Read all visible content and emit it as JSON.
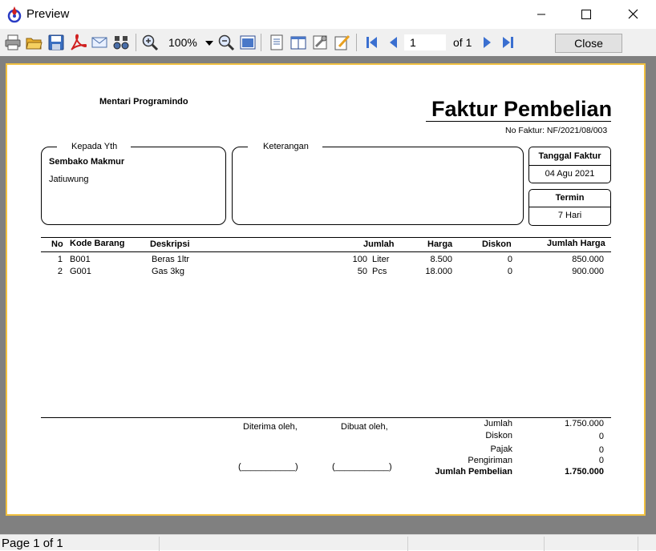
{
  "window": {
    "title": "Preview",
    "icon": "app-icon"
  },
  "toolbar": {
    "icons": [
      "print-icon",
      "open-icon",
      "save-icon",
      "pdf-icon",
      "email-icon",
      "find-icon",
      "zoom-in-icon",
      "zoom-out-icon",
      "fit-page-icon",
      "page-setup-icon",
      "two-page-icon",
      "tools-icon",
      "edit-icon",
      "first-page-icon",
      "prev-page-icon",
      "next-page-icon",
      "last-page-icon"
    ],
    "zoom": "100%",
    "page_value": "1",
    "of_label": "of 1",
    "close_label": "Close"
  },
  "report": {
    "company": "Mentari Programindo",
    "title": "Faktur Pembelian",
    "faktur_no": "No Faktur: NF/2021/08/003",
    "kepada_label": "Kepada Yth",
    "customer_name": "Sembako Makmur",
    "customer_address": "Jatiuwung",
    "keterangan_label": "Keterangan",
    "tanggal_label": "Tanggal Faktur",
    "tanggal_value": "04 Agu 2021",
    "termin_label": "Termin",
    "termin_value": "7 Hari",
    "columns": {
      "no": "No",
      "kode": "Kode Barang",
      "deskripsi": "Deskripsi",
      "jumlah": "Jumlah",
      "harga": "Harga",
      "diskon": "Diskon",
      "jumlah_harga": "Jumlah Harga"
    },
    "rows": [
      {
        "no": "1",
        "kode": "B001",
        "deskripsi": "Beras 1ltr",
        "qty": "100",
        "unit": "Liter",
        "harga": "8.500",
        "diskon": "0",
        "jumlah_harga": "850.000"
      },
      {
        "no": "2",
        "kode": "G001",
        "deskripsi": "Gas 3kg",
        "qty": "50",
        "unit": "Pcs",
        "harga": "18.000",
        "diskon": "0",
        "jumlah_harga": "900.000"
      }
    ],
    "diterima_label": "Diterima oleh,",
    "dibuat_label": "Dibuat oleh,",
    "sign_placeholder": "(___________)",
    "totals": {
      "jumlah_label": "Jumlah",
      "jumlah_value": "1.750.000",
      "diskon_label": "Diskon",
      "diskon_value": "0",
      "pajak_label": "Pajak",
      "pajak_value": "0",
      "pengiriman_label": "Pengiriman",
      "pengiriman_value": "0",
      "total_label": "Jumlah Pembelian",
      "total_value": "1.750.000"
    }
  },
  "status": {
    "page_text": "Page 1 of 1"
  }
}
